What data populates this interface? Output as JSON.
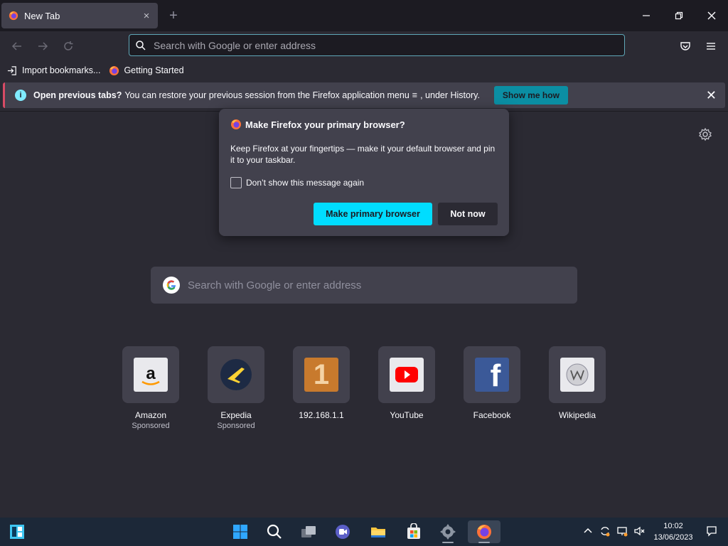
{
  "tab": {
    "title": "New Tab",
    "close": "×"
  },
  "newtab": "+",
  "window": {
    "minimize": "—",
    "restore": "❐",
    "close": "✕"
  },
  "urlbar": {
    "placeholder": "Search with Google or enter address"
  },
  "bookmarks": [
    {
      "label": "Import bookmarks..."
    },
    {
      "label": "Getting Started"
    }
  ],
  "notification": {
    "bold": "Open previous tabs?",
    "message_1": "You can restore your previous session from the Firefox application menu",
    "message_2": ", under History.",
    "button": "Show me how"
  },
  "popup": {
    "title": "Make Firefox your primary browser?",
    "body": "Keep Firefox at your fingertips — make it your default browser and pin it to your taskbar.",
    "checkbox_label": "Don’t show this message again",
    "primary_button": "Make primary browser",
    "secondary_button": "Not now"
  },
  "search": {
    "placeholder": "Search with Google or enter address"
  },
  "tiles": [
    {
      "label": "Amazon",
      "sub": "Sponsored"
    },
    {
      "label": "Expedia",
      "sub": "Sponsored"
    },
    {
      "label": "192.168.1.1",
      "sub": ""
    },
    {
      "label": "YouTube",
      "sub": ""
    },
    {
      "label": "Facebook",
      "sub": ""
    },
    {
      "label": "Wikipedia",
      "sub": ""
    }
  ],
  "tile_icon_text": {
    "ip": "1",
    "facebook": "f"
  },
  "clock": {
    "time": "10:02",
    "date": "13/06/2023"
  },
  "colors": {
    "accent": "#00ddff",
    "notif_button": "#0b8ea3",
    "urlbar_border": "#5fa7b8",
    "taskbar": "#1c2838"
  }
}
